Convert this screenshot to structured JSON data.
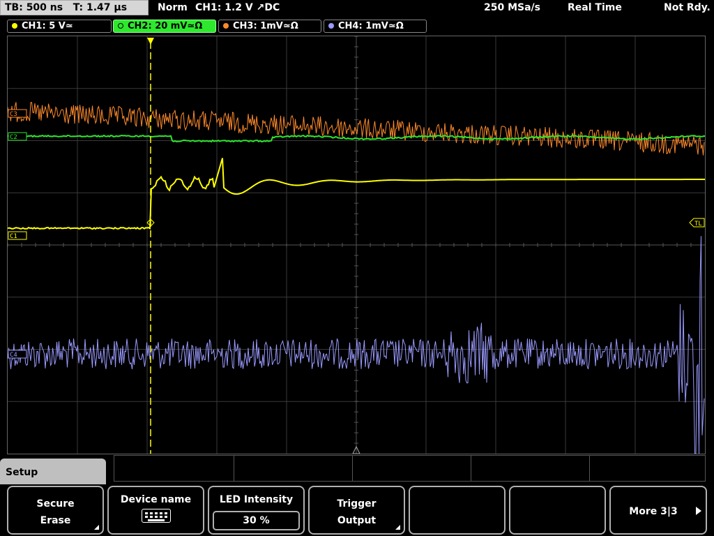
{
  "topbar": {
    "timebase": "TB: 500 ns",
    "trigger_time": "T: 1.47 µs",
    "mode": "Norm",
    "trigger_info": "CH1: 1.2 V ↗DC",
    "sample_rate": "250 MSa/s",
    "acquisition": "Real Time",
    "status": "Not Rdy."
  },
  "channels": [
    {
      "label": "CH1: 5 V≃",
      "color": "#ffff00",
      "active": false
    },
    {
      "label": "CH2: 20 mV≃Ω",
      "color": "#2ee82e",
      "active": true
    },
    {
      "label": "CH3: 1mV≃Ω",
      "color": "#ff8a2a",
      "active": false
    },
    {
      "label": "CH4: 1mV≃Ω",
      "color": "#9a9aff",
      "active": false
    }
  ],
  "markers": {
    "ch1": "C1",
    "ch2": "C2",
    "ch3": "C3",
    "ch4": "C4",
    "trigger_level": "TL",
    "trigger_position": "T"
  },
  "menu": {
    "tab_title": "Setup",
    "softkeys": [
      {
        "line1": "Secure",
        "line2": "Erase"
      },
      {
        "line1": "Device name",
        "icon": "keyboard-icon"
      },
      {
        "line1": "LED Intensity",
        "value": "30 %"
      },
      {
        "line1": "Trigger",
        "line2": "Output"
      },
      {
        "line1": ""
      },
      {
        "line1": ""
      },
      {
        "line1": "More 3|3"
      }
    ]
  },
  "colors": {
    "ch1": "#ffff00",
    "ch2": "#2ee82e",
    "ch3": "#ff8a2a",
    "ch4": "#9a9aff",
    "grid": "#3a3a3a"
  }
}
